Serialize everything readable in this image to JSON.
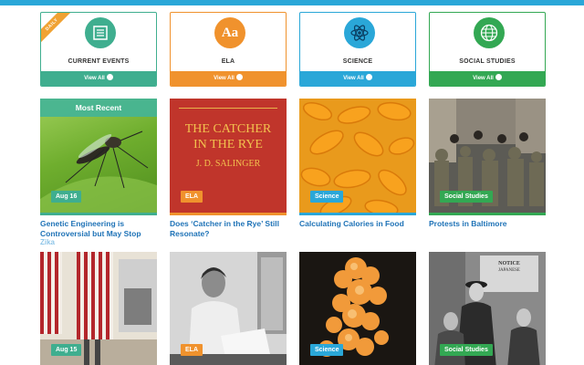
{
  "colors": {
    "current_events": "#3fae8f",
    "ela": "#f0922d",
    "science": "#2aa7d8",
    "social_studies": "#33a853"
  },
  "categories": [
    {
      "title": "CURRENT EVENTS",
      "view_all": "View All",
      "icon": "newspaper-icon",
      "ribbon": "DAILY"
    },
    {
      "title": "ELA",
      "view_all": "View All",
      "icon": "aa-letters-icon",
      "icon_text": "Aa"
    },
    {
      "title": "SCIENCE",
      "view_all": "View All",
      "icon": "atom-icon"
    },
    {
      "title": "SOCIAL STUDIES",
      "view_all": "View All",
      "icon": "globe-icon"
    }
  ],
  "row1": [
    {
      "overlay": "Most Recent",
      "badge": "Aug 16",
      "headline": "Genetic Engineering is Controversial but May Stop",
      "subtag": "Zika",
      "image": "mosquito-photo"
    },
    {
      "badge": "ELA",
      "headline": "Does ‘Catcher in the Rye’ Still Resonate?",
      "image": "book-cover",
      "book_title_1": "THE CATCHER",
      "book_title_2": "IN THE RYE",
      "book_author": "J. D. SALINGER"
    },
    {
      "badge": "Science",
      "headline": "Calculating Calories in Food",
      "image": "cheese-puffs-photo"
    },
    {
      "badge": "Social Studies",
      "headline": "Protests in Baltimore",
      "image": "protest-photo"
    }
  ],
  "row2": [
    {
      "badge": "Aug 15",
      "image": "voting-booth-photo"
    },
    {
      "badge": "ELA",
      "image": "writer-photo"
    },
    {
      "badge": "Science",
      "image": "coral-photo"
    },
    {
      "badge": "Social Studies",
      "image": "historic-crowd-photo",
      "notice_1": "NOTICE",
      "notice_2": "JAPANESE"
    }
  ]
}
